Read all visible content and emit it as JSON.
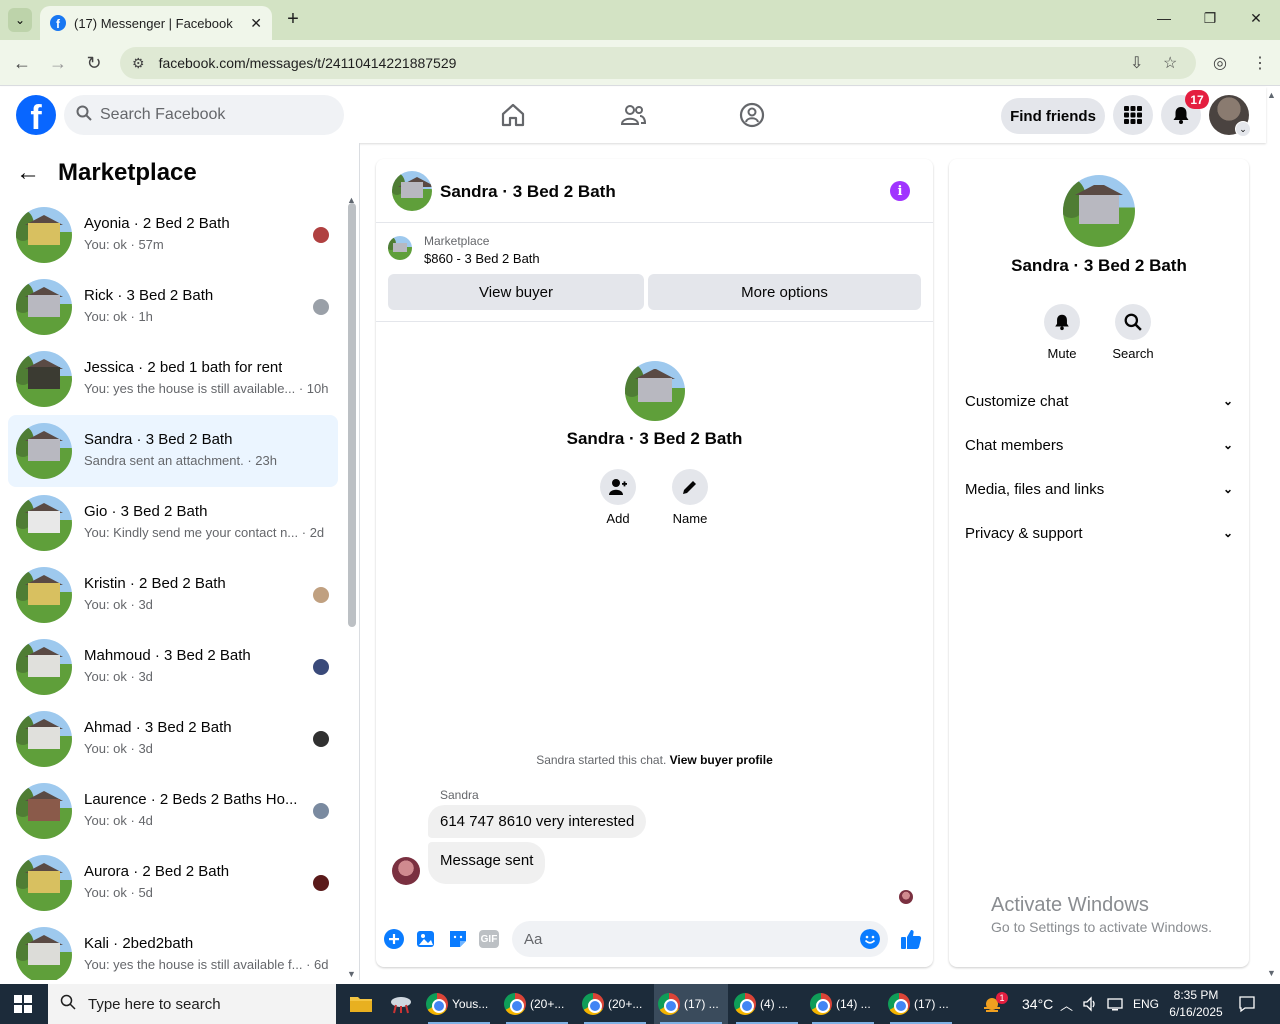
{
  "browser": {
    "tab_title": "(17) Messenger | Facebook",
    "tab_close": "✕",
    "new_tab": "+",
    "url": "facebook.com/messages/t/24110414221887529",
    "win_min": "—",
    "win_max": "❐",
    "win_close": "✕"
  },
  "header": {
    "search_placeholder": "Search Facebook",
    "find_friends": "Find friends",
    "notifications_count": "17"
  },
  "left": {
    "title": "Marketplace",
    "conversations": [
      {
        "name": "Ayonia · 2 Bed 2 Bath",
        "preview": "You: ok · 57m",
        "house": "#d8c060",
        "mini": "#b04040"
      },
      {
        "name": "Rick · 3 Bed 2 Bath",
        "preview": "You: ok · 1h",
        "house": "#b8b8c0",
        "mini": "#9aa0a8"
      },
      {
        "name": "Jessica · 2 bed 1 bath for rent",
        "preview": "You: yes the house is still available... · 10h",
        "house": "#3b3b32",
        "mini": ""
      },
      {
        "name": "Sandra · 3 Bed 2 Bath",
        "preview": "Sandra sent an attachment. · 23h",
        "house": "#b8b8c0",
        "mini": ""
      },
      {
        "name": "Gio · 3 Bed 2 Bath",
        "preview": "You: Kindly send me your contact n... · 2d",
        "house": "#e8e8e8",
        "mini": ""
      },
      {
        "name": "Kristin · 2 Bed 2 Bath",
        "preview": "You: ok · 3d",
        "house": "#d8c060",
        "mini": "#c0a080"
      },
      {
        "name": "Mahmoud · 3 Bed 2 Bath",
        "preview": "You: ok · 3d",
        "house": "#e0e0dc",
        "mini": "#3a4a7a"
      },
      {
        "name": "Ahmad · 3 Bed 2 Bath",
        "preview": "You: ok · 3d",
        "house": "#e0e0dc",
        "mini": "#303030"
      },
      {
        "name": "Laurence · 2 Beds 2 Baths Ho...",
        "preview": "You: ok · 4d",
        "house": "#8a5a4a",
        "mini": "#7a8aa0"
      },
      {
        "name": "Aurora · 2 Bed 2 Bath",
        "preview": "You: ok · 5d",
        "house": "#d8c060",
        "mini": "#5a1a1a"
      },
      {
        "name": "Kali · 2bed2bath",
        "preview": "You: yes the house is still available f... · 6d",
        "house": "#dcdcd8",
        "mini": ""
      }
    ]
  },
  "chat": {
    "title": "Sandra · 3 Bed 2 Bath",
    "marketplace_label": "Marketplace",
    "listing": "$860 - 3 Bed 2 Bath",
    "view_buyer": "View buyer",
    "more_options": "More options",
    "center_name": "Sandra · 3 Bed 2 Bath",
    "add_label": "Add",
    "name_label": "Name",
    "started_text": "Sandra started this chat.",
    "view_buyer_profile": "View buyer profile",
    "sender": "Sandra",
    "msg1": "614 747 8610  very interested",
    "msg2": "Message sent",
    "composer_placeholder": "Aa",
    "gif": "GIF"
  },
  "right": {
    "name": "Sandra · 3 Bed 2 Bath",
    "mute": "Mute",
    "search": "Search",
    "items": [
      "Customize chat",
      "Chat members",
      "Media, files and links",
      "Privacy & support"
    ],
    "activate_title": "Activate Windows",
    "activate_sub": "Go to Settings to activate Windows."
  },
  "taskbar": {
    "search": "Type here to search",
    "apps": [
      "Yous...",
      "(20+...",
      "(20+...",
      "(17) ...",
      "(4) ...",
      "(14) ...",
      "(17) ..."
    ],
    "temp": "34°C",
    "lang": "ENG",
    "time": "8:35 PM",
    "date": "6/16/2025",
    "weather_badge": "1"
  }
}
